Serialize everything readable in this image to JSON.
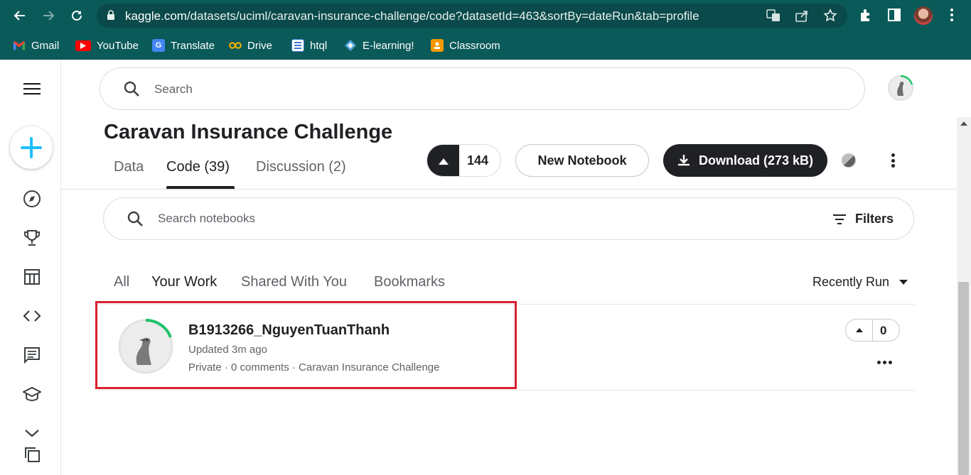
{
  "browser": {
    "url_host": "kaggle.com",
    "url_path": "/datasets/uciml/caravan-insurance-challenge/code?datasetId=463&sortBy=dateRun&tab=profile",
    "bookmarks": [
      {
        "label": "Gmail",
        "icon": "gmail-icon",
        "color": "#ea4335"
      },
      {
        "label": "YouTube",
        "icon": "youtube-icon",
        "color": "#ff0000"
      },
      {
        "label": "Translate",
        "icon": "translate-icon",
        "color": "#4285f4"
      },
      {
        "label": "Drive",
        "icon": "drive-icon",
        "color": "#f4b400"
      },
      {
        "label": "htql",
        "icon": "htql-icon",
        "color": "#3c7ad6"
      },
      {
        "label": "E-learning!",
        "icon": "elearning-icon",
        "color": "#4fa3d8"
      },
      {
        "label": "Classroom",
        "icon": "classroom-icon",
        "color": "#f29900"
      }
    ]
  },
  "kaggle": {
    "search_placeholder": "Search",
    "dataset_title": "Caravan Insurance Challenge",
    "tabs": [
      {
        "label": "Data",
        "active": false
      },
      {
        "label": "Code (39)",
        "active": true
      },
      {
        "label": "Discussion (2)",
        "active": false
      }
    ],
    "upvote_count": "144",
    "new_notebook_label": "New Notebook",
    "download_label": "Download (273 kB)",
    "notebook_search_placeholder": "Search notebooks",
    "filters_label": "Filters",
    "subtabs": [
      {
        "label": "All",
        "active": false
      },
      {
        "label": "Your Work",
        "active": true
      },
      {
        "label": "Shared With You",
        "active": false
      },
      {
        "label": "Bookmarks",
        "active": false
      }
    ],
    "sort_label": "Recently Run",
    "notebooks": [
      {
        "title": "B1913266_NguyenTuanThanh",
        "updated": "Updated 3m ago",
        "meta": "Private · 0 comments · Caravan Insurance Challenge",
        "votes": "0"
      }
    ],
    "accent_color": "#20beff",
    "highlight_color": "#d8202e"
  }
}
